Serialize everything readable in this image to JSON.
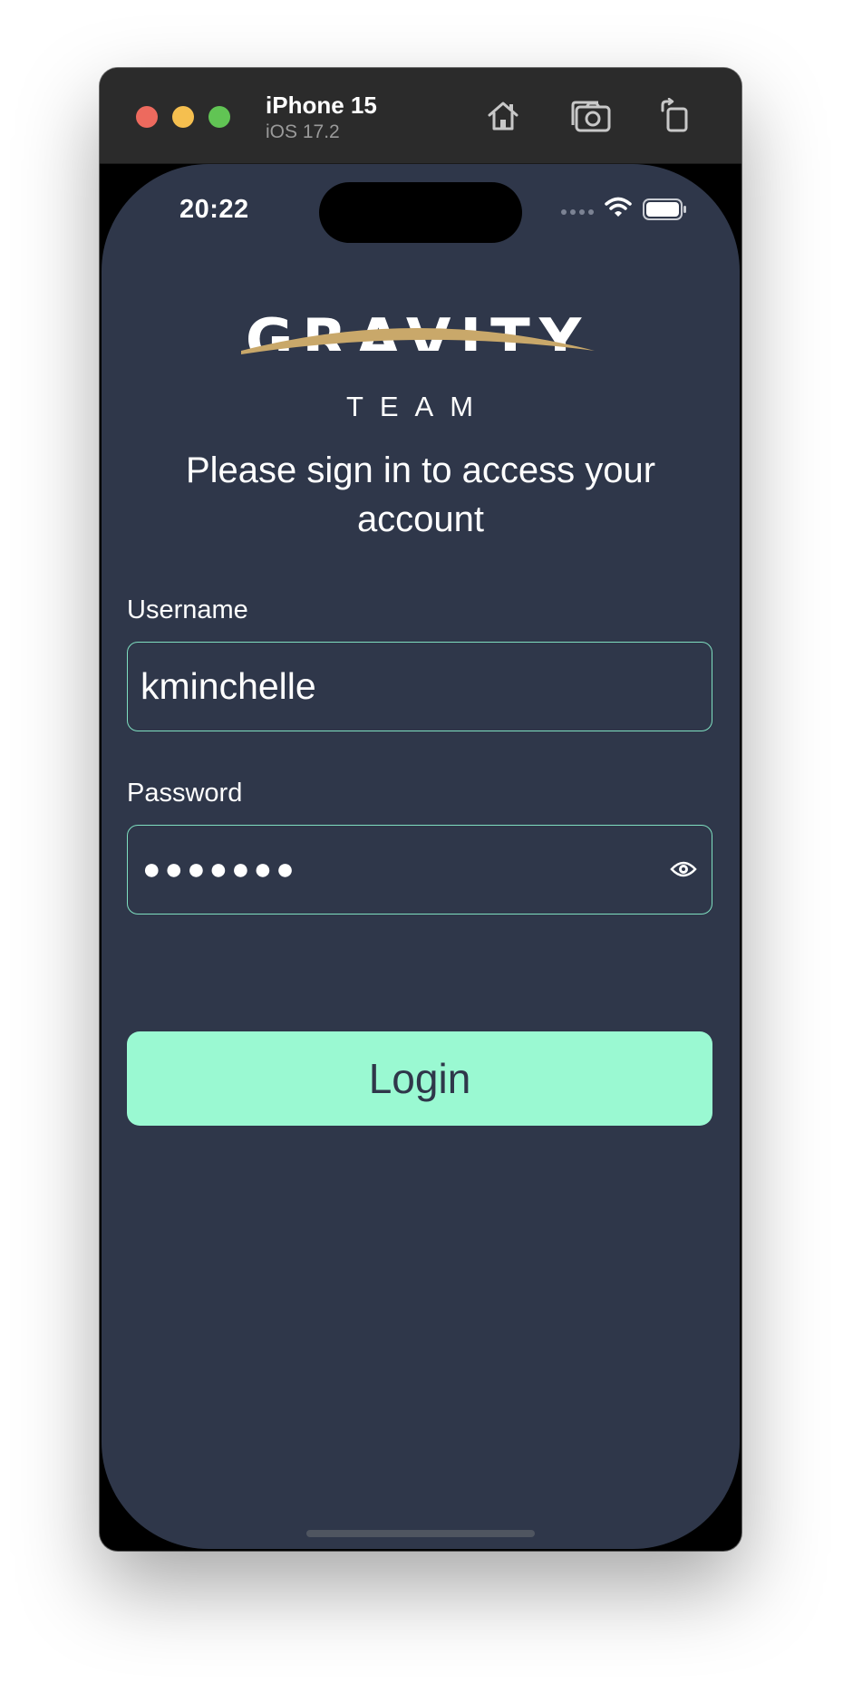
{
  "simulator": {
    "device_name": "iPhone 15",
    "os_version": "iOS 17.2",
    "toolbar_icons": [
      "home-icon",
      "screenshot-icon",
      "rotate-icon"
    ],
    "traffic_light_colors": {
      "close": "#ed6a5e",
      "minimize": "#f5bf4f",
      "zoom": "#61c454"
    }
  },
  "status_bar": {
    "time": "20:22",
    "icons": [
      "signal-dots-icon",
      "wifi-icon",
      "battery-icon"
    ]
  },
  "logo": {
    "word": "GRAVITY",
    "subword": "TEAM",
    "accent_color": "#c9a86a"
  },
  "login": {
    "heading": "Please sign in to access your account",
    "username_label": "Username",
    "username_value": "kminchelle",
    "password_label": "Password",
    "password_mask": "●●●●●●●",
    "reveal_icon": "eye-icon",
    "button_label": "Login"
  },
  "colors": {
    "background": "#2f374a",
    "input_border": "#7fdfc0",
    "button_bg": "#9af9d2",
    "button_text": "#2f374a"
  }
}
